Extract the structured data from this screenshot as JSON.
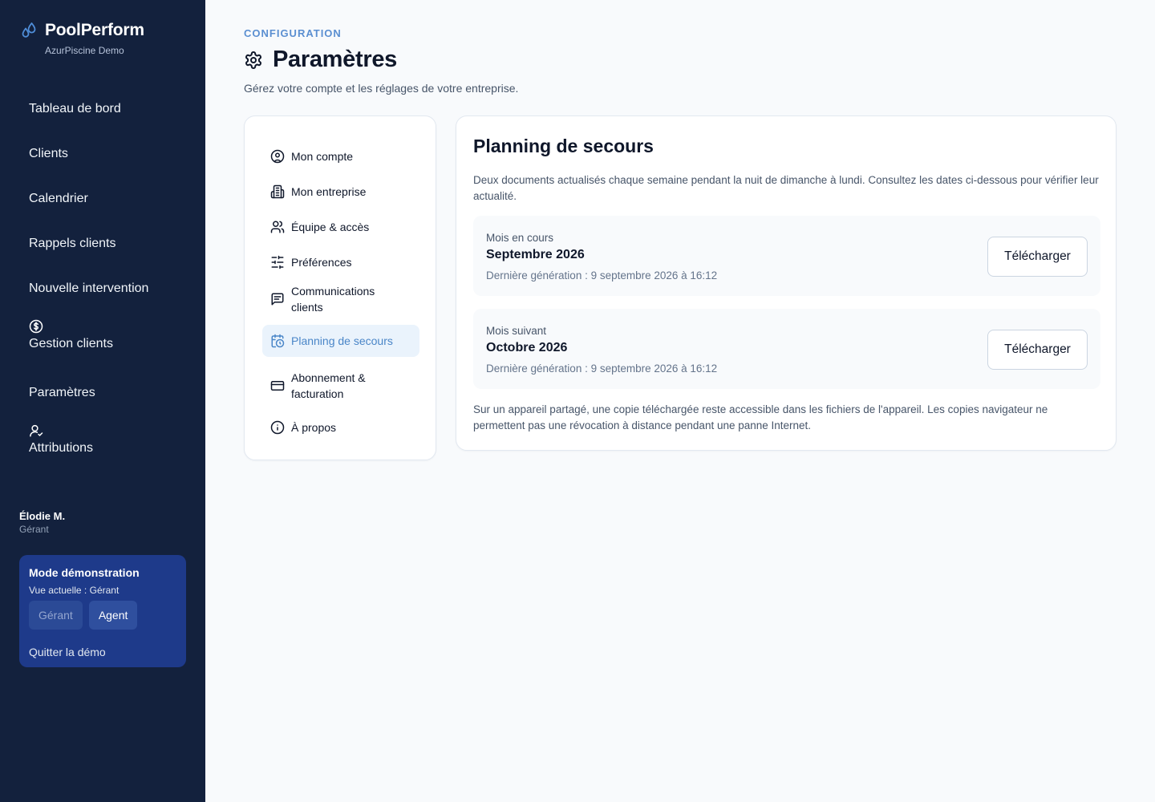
{
  "brand": {
    "name": "PoolPerform",
    "subtitle": "AzurPiscine Demo",
    "accent": "#4f8ed9"
  },
  "sidebar": {
    "items": [
      {
        "label": "Tableau de bord"
      },
      {
        "label": "Clients"
      },
      {
        "label": "Calendrier"
      },
      {
        "label": "Rappels clients"
      },
      {
        "label": "Nouvelle intervention"
      },
      {
        "label": "Gestion clients",
        "icon": "dollar-circle-icon"
      },
      {
        "label": "Paramètres"
      },
      {
        "label": "Attributions",
        "icon": "user-icon"
      }
    ],
    "user": {
      "name": "Élodie M.",
      "role": "Gérant"
    },
    "demo": {
      "title": "Mode démonstration",
      "current_view": "Vue actuelle : Gérant",
      "btn_manager": "Gérant",
      "btn_agent": "Agent",
      "quit": "Quitter la démo"
    }
  },
  "header": {
    "eyebrow": "CONFIGURATION",
    "title": "Paramètres",
    "subtitle": "Gérez votre compte et les réglages de votre entreprise."
  },
  "settings_menu": {
    "items": [
      {
        "label": "Mon compte",
        "icon": "user-circle-icon"
      },
      {
        "label": "Mon entreprise",
        "icon": "building-icon"
      },
      {
        "label": "Équipe & accès",
        "icon": "users-icon"
      },
      {
        "label": "Préférences",
        "icon": "sliders-icon"
      },
      {
        "label": "Communications clients",
        "icon": "message-icon"
      },
      {
        "label": "Planning de secours",
        "icon": "calendar-clock-icon",
        "active": true
      },
      {
        "label": "Abonnement & facturation",
        "icon": "credit-card-icon"
      },
      {
        "label": "À propos",
        "icon": "info-icon"
      }
    ]
  },
  "content": {
    "title": "Planning de secours",
    "description": "Deux documents actualisés chaque semaine pendant la nuit de dimanche à lundi. Consultez les dates ci-dessous pour vérifier leur actualité.",
    "documents": [
      {
        "label": "Mois en cours",
        "month": "Septembre 2026",
        "generated": "Dernière génération : 9 septembre 2026 à 16:12",
        "button": "Télécharger"
      },
      {
        "label": "Mois suivant",
        "month": "Octobre 2026",
        "generated": "Dernière génération : 9 septembre 2026 à 16:12",
        "button": "Télécharger"
      }
    ],
    "note": "Sur un appareil partagé, une copie téléchargée reste accessible dans les fichiers de l'appareil. Les copies navigateur ne permettent pas une révocation à distance pendant une panne Internet."
  }
}
